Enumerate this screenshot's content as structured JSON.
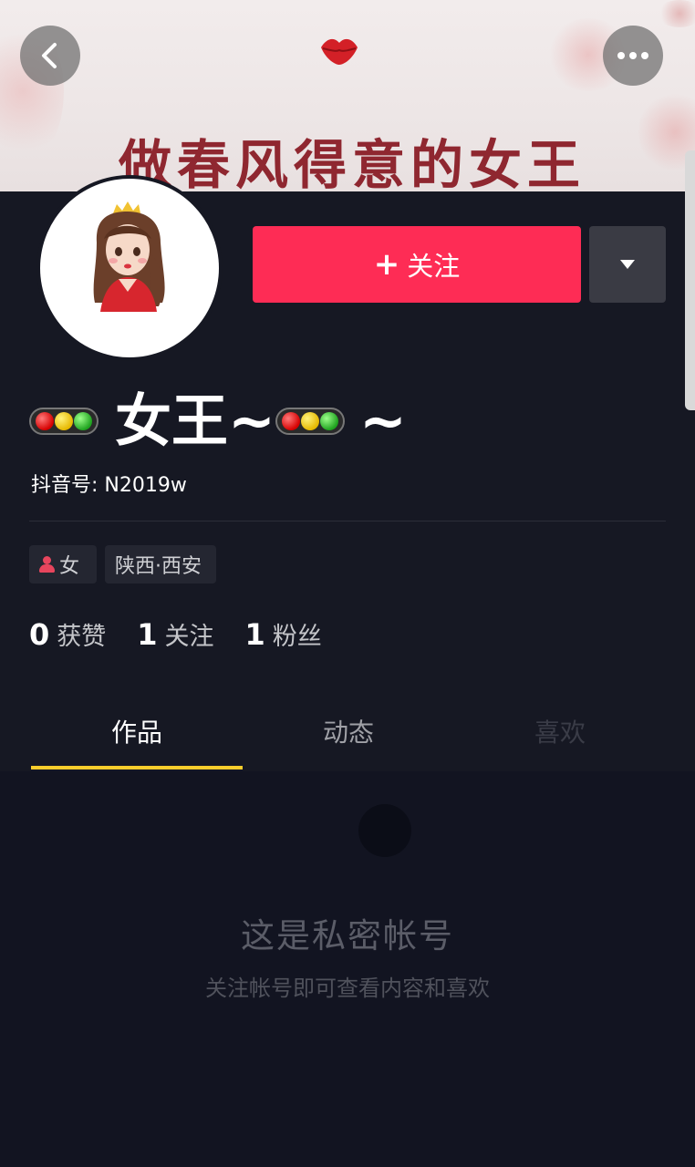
{
  "banner": {
    "text": "做春风得意的女王"
  },
  "icons": {
    "back": "chevron-left-icon",
    "more": "more-horizontal-icon",
    "dropdown": "caret-down-icon",
    "gender": "female-person-icon",
    "traffic_light": "traffic-light-emoji"
  },
  "profile": {
    "name_part1": "女王~",
    "name_part2": "~",
    "douyin_id": "抖音号: N2019w",
    "follow_label": "关注",
    "follow_plus": "+",
    "gender_tag": "女",
    "location_tag": "陕西·西安"
  },
  "stats": [
    {
      "value": "0",
      "label": "获赞"
    },
    {
      "value": "1",
      "label": "关注"
    },
    {
      "value": "1",
      "label": "粉丝"
    }
  ],
  "tabs": [
    {
      "label": "作品",
      "active": true
    },
    {
      "label": "动态",
      "active": false
    },
    {
      "label": "喜欢",
      "active": false
    }
  ],
  "private_notice": {
    "title": "这是私密帐号",
    "subtitle": "关注帐号即可查看内容和喜欢"
  },
  "colors": {
    "background": "#161823",
    "follow_button": "#fe2c55",
    "tab_indicator": "#facd2c",
    "banner_text": "#8f2730"
  }
}
